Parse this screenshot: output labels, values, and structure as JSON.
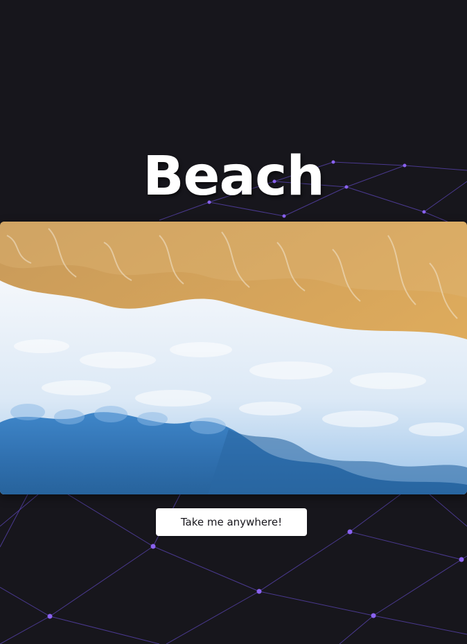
{
  "page": {
    "title": "Beach",
    "background_color": "#17161c",
    "accent_color": "#8a62f0"
  },
  "hero": {
    "image_subject": "aerial view of ocean waves meeting sandy beach",
    "colors": {
      "sand": "#d9a65a",
      "foam": "#eef3fa",
      "water": "#2f6fae"
    }
  },
  "cta": {
    "label": "Take me anywhere!"
  }
}
